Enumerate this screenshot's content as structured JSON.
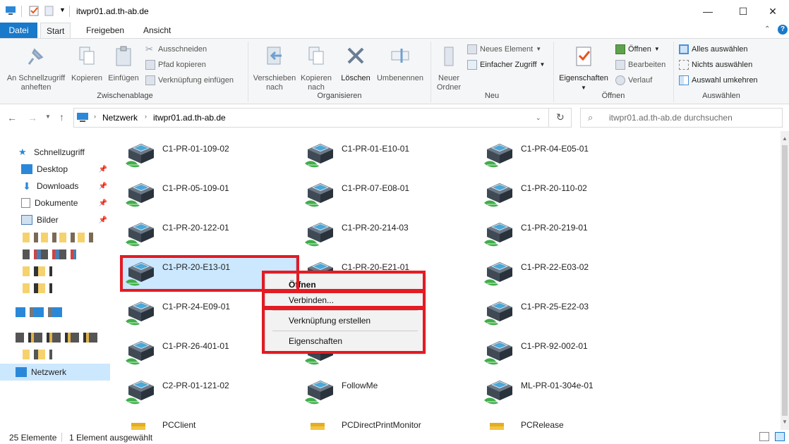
{
  "window": {
    "title": "itwpr01.ad.th-ab.de",
    "minimize": "—",
    "maximize": "☐",
    "close": "✕"
  },
  "ribbon_tabs": [
    "Datei",
    "Start",
    "Freigeben",
    "Ansicht"
  ],
  "ribbon": {
    "clipboard": {
      "pin": "An Schnellzugriff anheften",
      "copy": "Kopieren",
      "paste": "Einfügen",
      "cut": "Ausschneiden",
      "copy_path": "Pfad kopieren",
      "paste_shortcut": "Verknüpfung einfügen",
      "label": "Zwischenablage"
    },
    "organize": {
      "move": "Verschieben nach",
      "copyto": "Kopieren nach",
      "delete": "Löschen",
      "rename": "Umbenennen",
      "label": "Organisieren"
    },
    "new": {
      "folder": "Neuer Ordner",
      "new_item": "Neues Element",
      "easy_access": "Einfacher Zugriff",
      "label": "Neu"
    },
    "open": {
      "properties": "Eigenschaften",
      "open": "Öffnen",
      "edit": "Bearbeiten",
      "history": "Verlauf",
      "label": "Öffnen"
    },
    "select": {
      "all": "Alles auswählen",
      "none": "Nichts auswählen",
      "invert": "Auswahl umkehren",
      "label": "Auswählen"
    }
  },
  "address": {
    "crumb1": "Netzwerk",
    "crumb2": "itwpr01.ad.th-ab.de",
    "search_placeholder": "itwpr01.ad.th-ab.de durchsuchen"
  },
  "nav": {
    "quick": "Schnellzugriff",
    "desktop": "Desktop",
    "downloads": "Downloads",
    "docs": "Dokumente",
    "pics": "Bilder",
    "network": "Netzwerk"
  },
  "items": [
    {
      "name": "C1-PR-01-109-02",
      "kind": "printer"
    },
    {
      "name": "C1-PR-01-E10-01",
      "kind": "printer"
    },
    {
      "name": "C1-PR-04-E05-01",
      "kind": "printer"
    },
    {
      "name": "C1-PR-05-109-01",
      "kind": "printer"
    },
    {
      "name": "C1-PR-07-E08-01",
      "kind": "printer"
    },
    {
      "name": "C1-PR-20-110-02",
      "kind": "printer"
    },
    {
      "name": "C1-PR-20-122-01",
      "kind": "printer"
    },
    {
      "name": "C1-PR-20-214-03",
      "kind": "printer"
    },
    {
      "name": "C1-PR-20-219-01",
      "kind": "printer"
    },
    {
      "name": "C1-PR-20-E13-01",
      "kind": "printer"
    },
    {
      "name": "C1-PR-20-E21-01",
      "kind": "printer"
    },
    {
      "name": "C1-PR-22-E03-02",
      "kind": "printer"
    },
    {
      "name": "C1-PR-24-E09-01",
      "kind": "printer"
    },
    {
      "name": "",
      "kind": "printer"
    },
    {
      "name": "C1-PR-25-E22-03",
      "kind": "printer"
    },
    {
      "name": "C1-PR-26-401-01",
      "kind": "printer"
    },
    {
      "name": "",
      "kind": "printer"
    },
    {
      "name": "C1-PR-92-002-01",
      "kind": "printer"
    },
    {
      "name": "C2-PR-01-121-02",
      "kind": "printer"
    },
    {
      "name": "FollowMe",
      "kind": "printer"
    },
    {
      "name": "ML-PR-01-304e-01",
      "kind": "printer"
    },
    {
      "name": "PCClient",
      "kind": "folder"
    },
    {
      "name": "PCDirectPrintMonitor",
      "kind": "folder"
    },
    {
      "name": "PCRelease",
      "kind": "folder"
    }
  ],
  "context_menu": {
    "open": "Öffnen",
    "connect": "Verbinden...",
    "shortcut": "Verknüpfung erstellen",
    "properties": "Eigenschaften"
  },
  "status": {
    "count": "25 Elemente",
    "selected": "1 Element ausgewählt"
  },
  "colors": {
    "accent": "#1979ca",
    "selection": "#cce8ff",
    "highlight_box": "#e31b23"
  }
}
